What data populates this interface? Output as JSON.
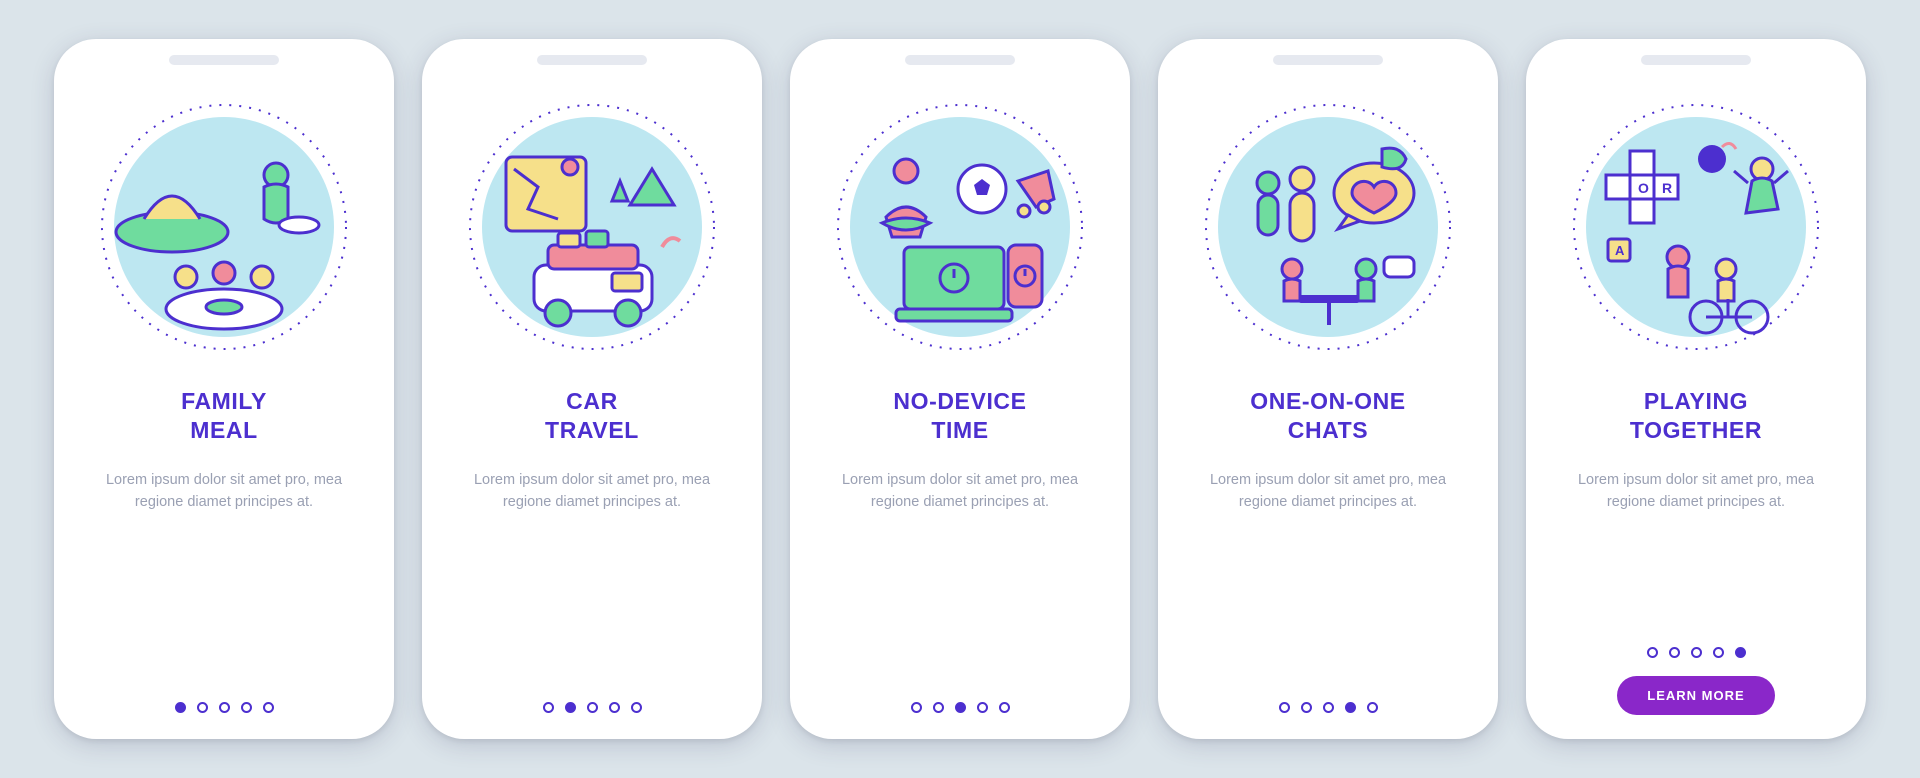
{
  "common": {
    "description": "Lorem ipsum dolor sit amet pro, mea regione diamet principes at.",
    "cta_label": "LEARN MORE",
    "total_screens": 5
  },
  "colors": {
    "primary": "#4c2fcf",
    "accent": "#8a27c9",
    "text_muted": "#9aa0b3",
    "bg": "#dbe4ea",
    "illus_bg": "#bde7f1",
    "green": "#6fdc9e",
    "pink": "#f08c9b",
    "yellow": "#f6e08a",
    "stroke": "#4c2fcf"
  },
  "screens": [
    {
      "title": "Family\nMeal",
      "icon": "family-meal-icon",
      "active_index": 0,
      "has_cta": false
    },
    {
      "title": "Car\nTravel",
      "icon": "car-travel-icon",
      "active_index": 1,
      "has_cta": false
    },
    {
      "title": "No-Device\nTime",
      "icon": "no-device-time-icon",
      "active_index": 2,
      "has_cta": false
    },
    {
      "title": "One-on-One\nChats",
      "icon": "one-on-one-chats-icon",
      "active_index": 3,
      "has_cta": false
    },
    {
      "title": "Playing\nTogether",
      "icon": "playing-together-icon",
      "active_index": 4,
      "has_cta": true
    }
  ]
}
